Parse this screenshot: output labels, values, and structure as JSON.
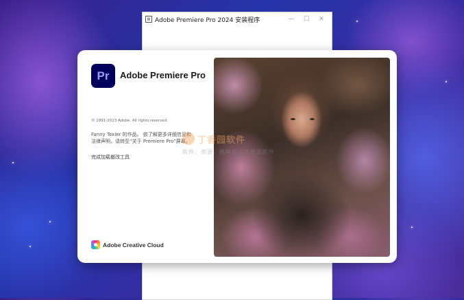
{
  "installer": {
    "title": "Adobe Premiere Pro 2024 安装程序",
    "app_icon_label": "Ⅲ",
    "minimize_glyph": "—",
    "maximize_glyph": "☐",
    "close_glyph": "✕"
  },
  "splash": {
    "logo_text": "Pr",
    "product_name": "Adobe Premiere Pro",
    "copyright": "© 1991-2023 Adobe. All rights reserved.",
    "credit": "Fanny Texier 的作品。 欲了解更多详细信息和法律声明，请转至“关于 Premiere Pro”屏幕。",
    "status": "完成加载撤改工具",
    "cc_label": "Adobe Creative Cloud"
  },
  "watermark": {
    "title": "丁香园软件",
    "subtitle": "软件、资源、教程就上丁香园软件"
  },
  "colors": {
    "pr_logo_bg": "#00005b",
    "pr_logo_text": "#9999ff"
  }
}
